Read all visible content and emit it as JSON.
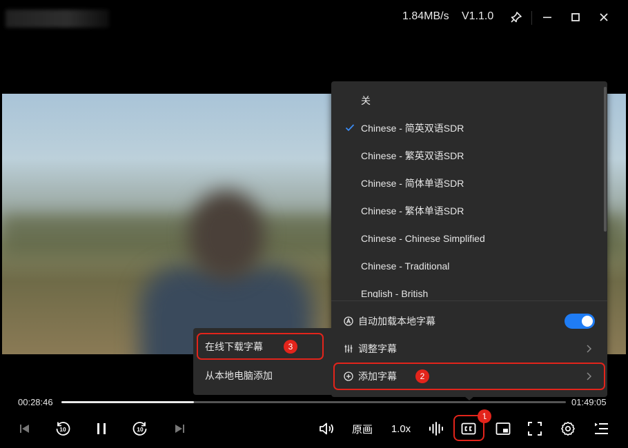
{
  "titlebar": {
    "speed": "1.84MB/s",
    "version": "V1.1.0",
    "icons": [
      "pin-icon",
      "minimize-icon",
      "maximize-icon",
      "close-icon"
    ]
  },
  "subtitle_menu": {
    "tracks": [
      {
        "label": "关",
        "selected": false
      },
      {
        "label": "Chinese - 简英双语SDR",
        "selected": true
      },
      {
        "label": "Chinese - 繁英双语SDR",
        "selected": false
      },
      {
        "label": "Chinese - 简体单语SDR",
        "selected": false
      },
      {
        "label": "Chinese - 繁体单语SDR",
        "selected": false
      },
      {
        "label": "Chinese - Chinese Simplified",
        "selected": false
      },
      {
        "label": "Chinese - Traditional",
        "selected": false
      },
      {
        "label": "English - British",
        "selected": false
      }
    ],
    "auto_load_label": "自动加载本地字幕",
    "auto_load_on": true,
    "adjust_label": "调整字幕",
    "add_label": "添加字幕"
  },
  "add_submenu": {
    "online_label": "在线下载字幕",
    "local_label": "从本地电脑添加"
  },
  "badges": {
    "b1": "1",
    "b2": "2",
    "b3": "3"
  },
  "player": {
    "current_time": "00:28:46",
    "total_time": "01:49:05",
    "progress": 0.263,
    "quality_label": "原画",
    "speed_label": "1.0x",
    "skip_back_label": "10",
    "skip_forward_label": "10"
  },
  "colors": {
    "accent": "#1f7cf4",
    "highlight": "#e3241b",
    "menu_bg": "#2b2b2b"
  }
}
